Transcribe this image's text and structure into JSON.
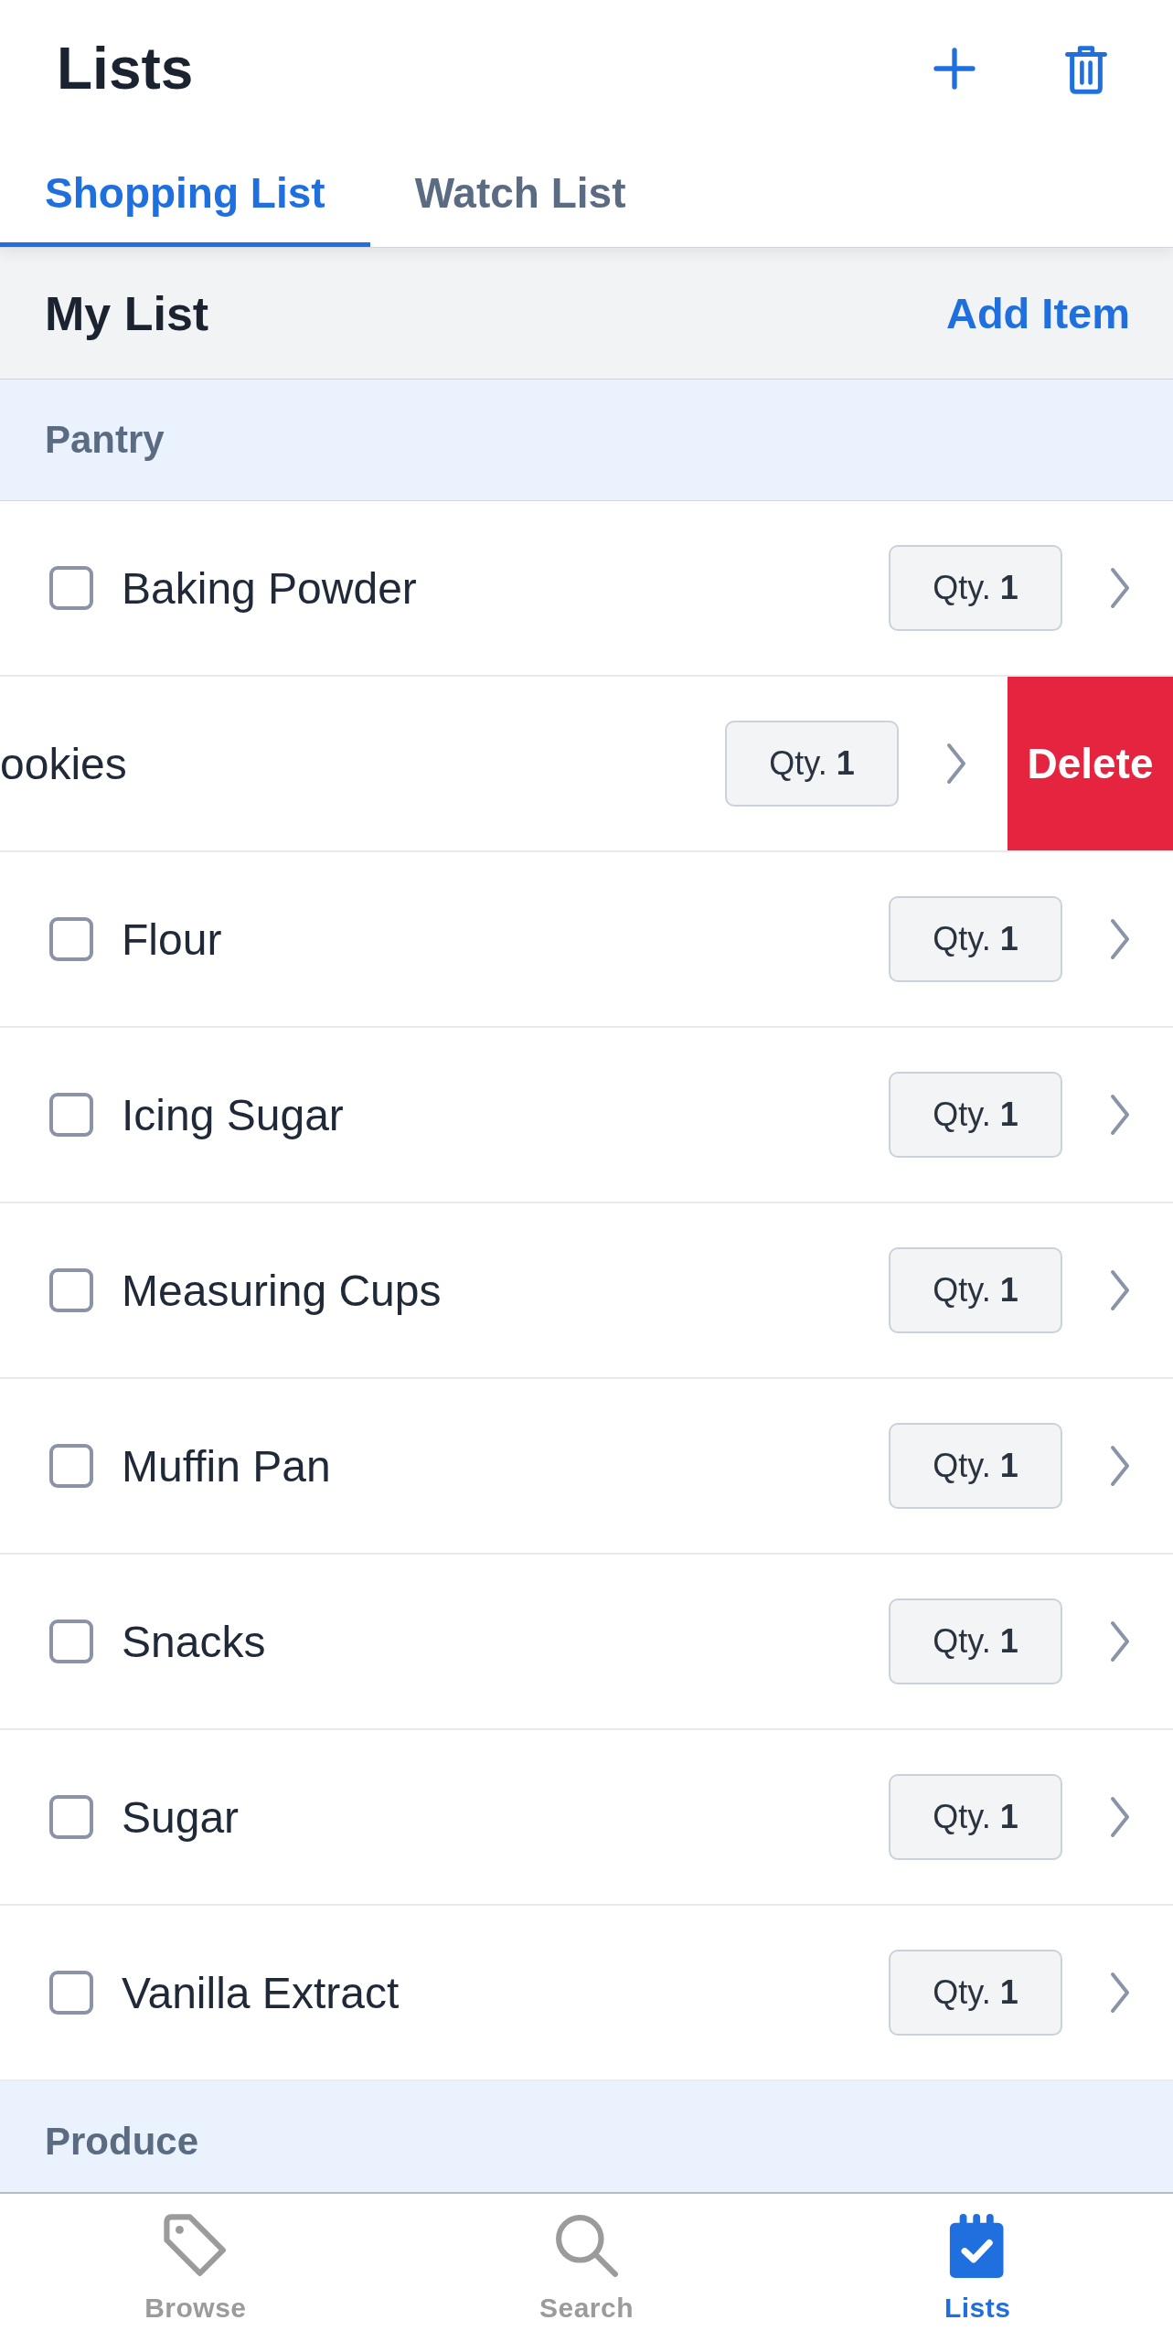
{
  "header": {
    "title": "Lists"
  },
  "tabs": [
    {
      "label": "Shopping List",
      "selected": true
    },
    {
      "label": "Watch List",
      "selected": false
    }
  ],
  "list": {
    "title": "My List",
    "action": "Add Item"
  },
  "sections": [
    {
      "name": "Pantry",
      "items": [
        {
          "kind": "item",
          "name": "Baking Powder",
          "checked": false,
          "qty": "Qty. **1**"
        },
        {
          "kind": "swiped",
          "name": "ookies",
          "qty": "Qty. **1**",
          "action": "Delete"
        },
        {
          "kind": "item",
          "name": "Flour",
          "checked": false,
          "qty": "Qty. **1**"
        },
        {
          "kind": "item",
          "name": "Icing Sugar",
          "checked": false,
          "qty": "Qty. **1**"
        },
        {
          "kind": "item",
          "name": "Measuring Cups",
          "checked": false,
          "qty": "Qty. **1**"
        },
        {
          "kind": "item",
          "name": "Muffin Pan",
          "checked": false,
          "qty": "Qty. **1**"
        },
        {
          "kind": "item",
          "name": "Snacks",
          "checked": false,
          "qty": "Qty. **1**"
        },
        {
          "kind": "item",
          "name": "Sugar",
          "checked": false,
          "qty": "Qty. **1**"
        },
        {
          "kind": "item",
          "name": "Vanilla Extract",
          "checked": false,
          "qty": "Qty. **1**"
        }
      ]
    },
    {
      "name": "Produce"
    }
  ],
  "tab_bar": [
    {
      "label": "Browse",
      "selected": false
    },
    {
      "label": "Search",
      "selected": false
    },
    {
      "label": "Lists",
      "selected": true
    }
  ]
}
